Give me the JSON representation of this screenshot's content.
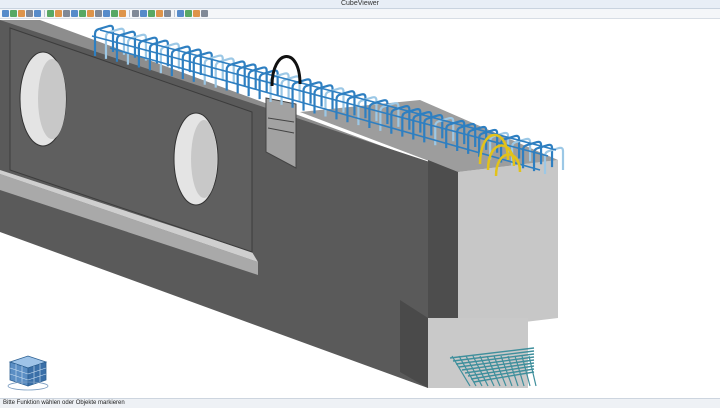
{
  "window": {
    "title": "CubeViewer"
  },
  "toolbar": {
    "icons": [
      "new-icon",
      "open-icon",
      "save-icon",
      "print-icon",
      "settings-icon",
      "separator",
      "select-icon",
      "view-icon",
      "zoom-in-icon",
      "zoom-out-icon",
      "zoom-window-icon",
      "pan-icon",
      "rotate-icon",
      "rotate-x-icon",
      "rotate-y-icon",
      "rotate-z-icon",
      "separator",
      "wireframe-icon",
      "shade-icon",
      "render-icon",
      "light-icon",
      "material-icon",
      "separator",
      "layer-icon",
      "measure-icon",
      "section-icon",
      "info-icon"
    ],
    "colors": {
      "icon_blue": "#3a78c2",
      "icon_green": "#3c9a4a",
      "icon_orange": "#d9822b",
      "icon_gray": "#6b7686"
    }
  },
  "viewport": {
    "model": "precast-beam-with-reinforcement",
    "colors": {
      "concrete_front": "#5c5c5c",
      "concrete_top": "#9a9a9a",
      "concrete_side": "#c4c4c4",
      "concrete_dark": "#4a4a4a",
      "opening": "#e6e6e6",
      "rebar_blue": "#2e7fc1",
      "rebar_light": "#9cc8e6",
      "rebar_black": "#111111",
      "rebar_yellow": "#e2c21a",
      "mesh_teal": "#3f8f9c"
    }
  },
  "nav_cube": {
    "icon": "navigation-cube-icon"
  },
  "status": {
    "message": "Bitte Funktion wählen oder Objekte markieren"
  }
}
